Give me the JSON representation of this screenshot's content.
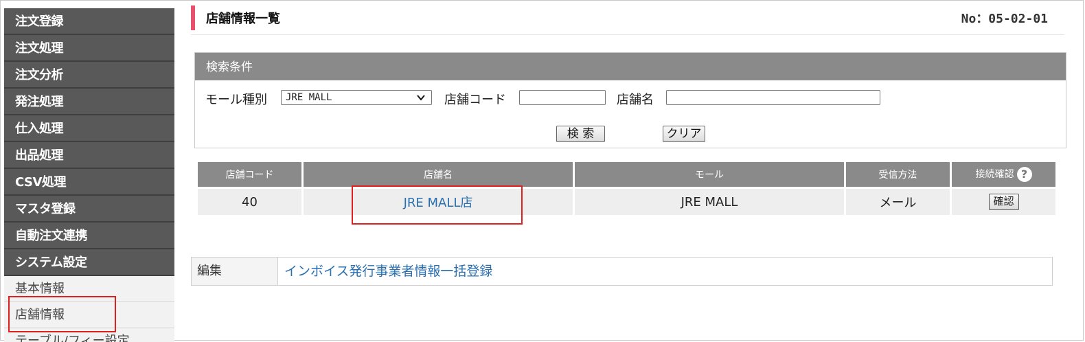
{
  "sidebar": {
    "menu": [
      {
        "label": "注文登録"
      },
      {
        "label": "注文処理"
      },
      {
        "label": "注文分析"
      },
      {
        "label": "発注処理"
      },
      {
        "label": "仕入処理"
      },
      {
        "label": "出品処理"
      },
      {
        "label": "CSV処理"
      },
      {
        "label": "マスタ登録"
      },
      {
        "label": "自動注文連携"
      },
      {
        "label": "システム設定"
      }
    ],
    "sub_items": [
      {
        "label": "基本情報"
      },
      {
        "label": "店舗情報"
      },
      {
        "label": "テーブル/フィー設定"
      }
    ]
  },
  "page": {
    "title": "店舗情報一覧",
    "number": "No：05-02-01"
  },
  "search": {
    "header": "検索条件",
    "mall_type_label": "モール種別",
    "mall_type_value": "JRE MALL",
    "store_code_label": "店舗コード",
    "store_code_value": "",
    "store_name_label": "店舗名",
    "store_name_value": "",
    "search_button": "検 索",
    "clear_button": "クリア"
  },
  "table": {
    "headers": {
      "store_code": "店舗コード",
      "store_name": "店舗名",
      "mall": "モール",
      "receive_method": "受信方法",
      "connection_check": "接続確認"
    },
    "rows": [
      {
        "store_code": "40",
        "store_name": "JRE MALL店",
        "mall": "JRE MALL",
        "receive_method": "メール",
        "confirm_button": "確認"
      }
    ]
  },
  "edit": {
    "label": "編集",
    "link": "インボイス発行事業者情報一括登録"
  },
  "colors": {
    "accent": "#e8506b",
    "highlight": "#e0201e",
    "link": "#2a6fb0",
    "sidebar_bg": "#595959"
  }
}
